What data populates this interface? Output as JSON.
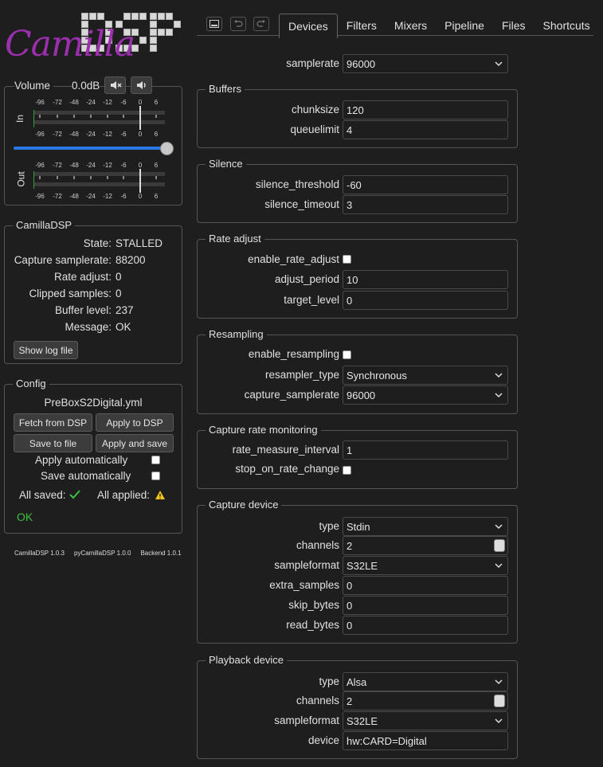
{
  "logo": {
    "part1": "Camilla",
    "part2": "DSP"
  },
  "volume": {
    "title": "Volume",
    "level": "0.0dB",
    "mute_icon": "speaker-muted-icon",
    "speaker_icon": "speaker-icon",
    "in_label": "In",
    "out_label": "Out",
    "scale": [
      "-96",
      "-72",
      "-48",
      "-24",
      "-12",
      "-6",
      "0",
      "6"
    ],
    "slider_value_db": 0
  },
  "status": {
    "title": "CamillaDSP",
    "rows": [
      {
        "k": "State:",
        "v": "STALLED"
      },
      {
        "k": "Capture samplerate:",
        "v": "88200"
      },
      {
        "k": "Rate adjust:",
        "v": "0"
      },
      {
        "k": "Clipped samples:",
        "v": "0"
      },
      {
        "k": "Buffer level:",
        "v": "237"
      },
      {
        "k": "Message:",
        "v": "OK"
      }
    ],
    "log_button": "Show log file"
  },
  "config": {
    "title": "Config",
    "filename": "PreBoxS2Digital.yml",
    "fetch": "Fetch from DSP",
    "apply": "Apply to DSP",
    "save": "Save to file",
    "apply_save": "Apply and save",
    "apply_auto": "Apply automatically",
    "save_auto": "Save automatically",
    "all_saved": "All saved:",
    "all_applied": "All applied:",
    "ok": "OK"
  },
  "versions": {
    "camilladsp": "CamillaDSP 1.0.3",
    "py": "pyCamillaDSP 1.0.0",
    "backend": "Backend 1.0.1"
  },
  "tabs": [
    "Devices",
    "Filters",
    "Mixers",
    "Pipeline",
    "Files",
    "Shortcuts"
  ],
  "devices": {
    "samplerate_label": "samplerate",
    "samplerate": "96000",
    "buffers_title": "Buffers",
    "chunksize_label": "chunksize",
    "chunksize": "120",
    "queuelimit_label": "queuelimit",
    "queuelimit": "4",
    "silence_title": "Silence",
    "silence_threshold_label": "silence_threshold",
    "silence_threshold": "-60",
    "silence_timeout_label": "silence_timeout",
    "silence_timeout": "3",
    "rate_title": "Rate adjust",
    "enable_rate_adjust_label": "enable_rate_adjust",
    "adjust_period_label": "adjust_period",
    "adjust_period": "10",
    "target_level_label": "target_level",
    "target_level": "0",
    "resampling_title": "Resampling",
    "enable_resampling_label": "enable_resampling",
    "resampler_type_label": "resampler_type",
    "resampler_type": "Synchronous",
    "capture_samplerate_label": "capture_samplerate",
    "capture_samplerate": "96000",
    "crm_title": "Capture rate monitoring",
    "rate_measure_interval_label": "rate_measure_interval",
    "rate_measure_interval": "1",
    "stop_on_rate_change_label": "stop_on_rate_change",
    "capture_title": "Capture device",
    "cap_type_label": "type",
    "cap_type": "Stdin",
    "cap_channels_label": "channels",
    "cap_channels": "2",
    "cap_format_label": "sampleformat",
    "cap_format": "S32LE",
    "extra_samples_label": "extra_samples",
    "extra_samples": "0",
    "skip_bytes_label": "skip_bytes",
    "skip_bytes": "0",
    "read_bytes_label": "read_bytes",
    "read_bytes": "0",
    "playback_title": "Playback device",
    "pb_type_label": "type",
    "pb_type": "Alsa",
    "pb_channels_label": "channels",
    "pb_channels": "2",
    "pb_format_label": "sampleformat",
    "pb_format": "S32LE",
    "pb_device_label": "device",
    "pb_device": "hw:CARD=Digital"
  }
}
